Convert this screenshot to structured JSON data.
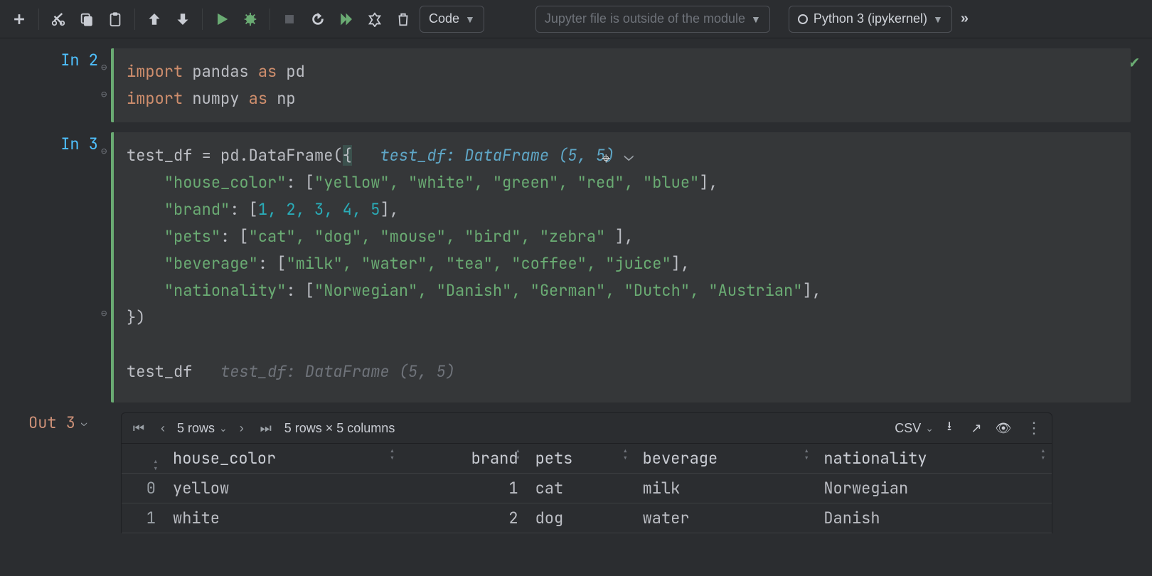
{
  "toolbar": {
    "cell_type": "Code",
    "context_msg": "Jupyter file is outside of the module",
    "kernel": "Python 3 (ipykernel)"
  },
  "cells": {
    "c1": {
      "prompt": "In 2",
      "line1_import": "import",
      "line1_mod": "pandas",
      "line1_as": "as",
      "line1_alias": "pd",
      "line2_import": "import",
      "line2_mod": "numpy",
      "line2_as": "as",
      "line2_alias": "np"
    },
    "c2": {
      "prompt": "In 3",
      "l1a": "test_df = pd.DataFrame(",
      "l1b": "{",
      "hint1": "test_df: DataFrame (5, 5)",
      "key_color": "\"house_color\"",
      "vals_color": "\"yellow\", \"white\", \"green\", \"red\", \"blue\"",
      "key_brand": "\"brand\"",
      "vals_brand": "1, 2, 3, 4, 5",
      "key_pets": "\"pets\"",
      "vals_pets": "\"cat\", \"dog\", \"mouse\", \"bird\", \"zebra\" ",
      "key_bev": "\"beverage\"",
      "vals_bev": "\"milk\", \"water\", \"tea\", \"coffee\", \"juice\"",
      "key_nat": "\"nationality\"",
      "vals_nat": "\"Norwegian\", \"Danish\", \"German\", \"Dutch\", \"Austrian\"",
      "close": "})",
      "expr": "test_df",
      "hint2": "test_df: DataFrame (5, 5)"
    }
  },
  "output": {
    "prompt": "Out 3",
    "rows_dd": "5 rows",
    "shape": "5 rows × 5 columns",
    "csv": "CSV",
    "headers": [
      "house_color",
      "brand",
      "pets",
      "beverage",
      "nationality"
    ],
    "rows": [
      {
        "idx": "0",
        "house_color": "yellow",
        "brand": "1",
        "pets": "cat",
        "beverage": "milk",
        "nationality": "Norwegian"
      },
      {
        "idx": "1",
        "house_color": "white",
        "brand": "2",
        "pets": "dog",
        "beverage": "water",
        "nationality": "Danish"
      }
    ]
  }
}
